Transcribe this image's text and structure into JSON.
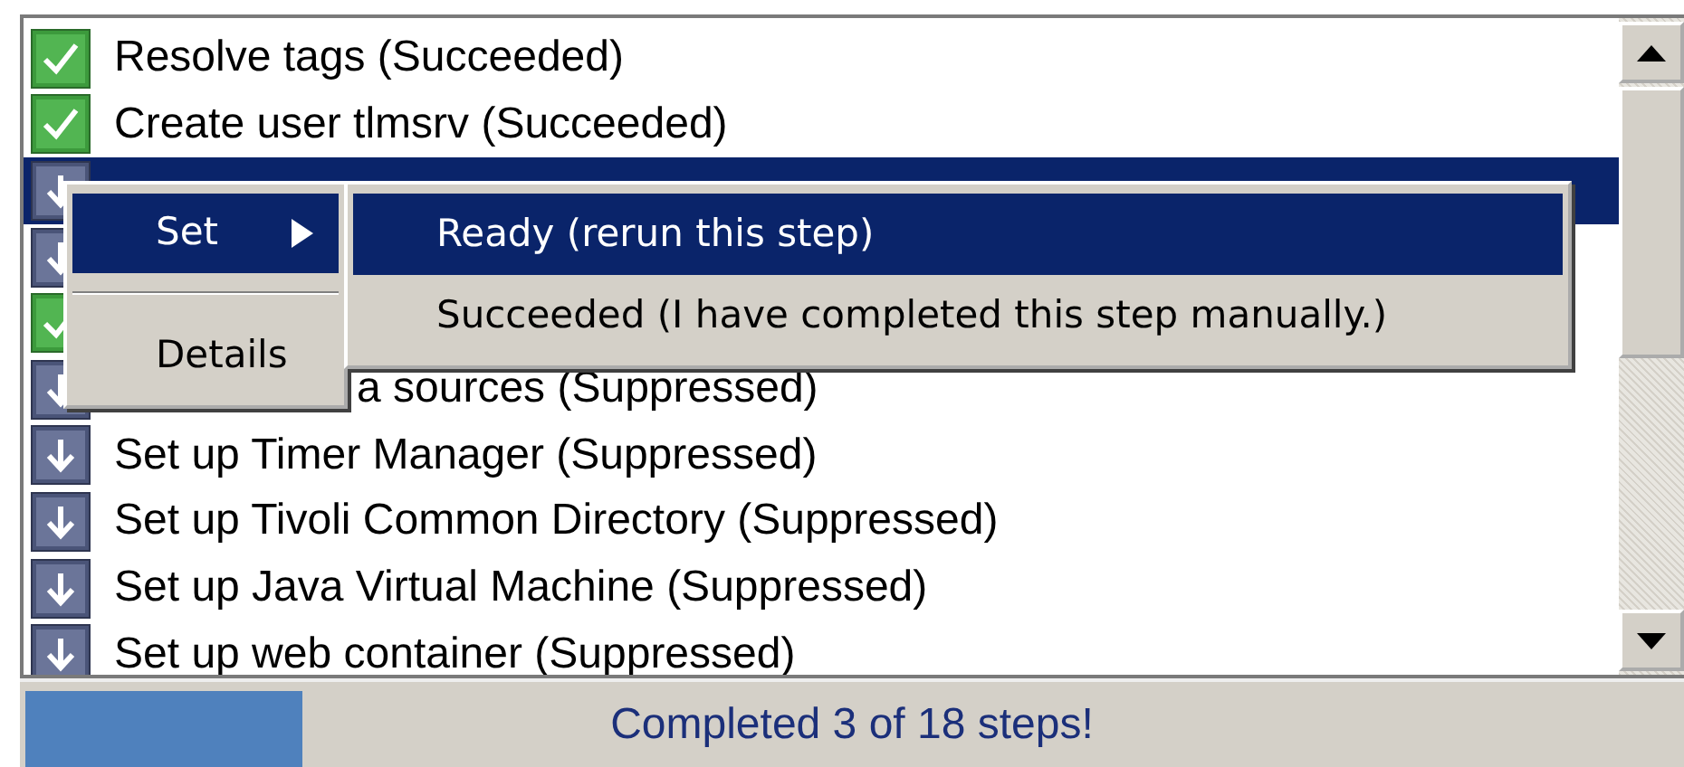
{
  "steps": [
    {
      "kind": "succeeded",
      "label": "Resolve tags  (Succeeded)",
      "selected": false
    },
    {
      "kind": "succeeded",
      "label": "Create user tlmsrv  (Succeeded)",
      "selected": false
    },
    {
      "kind": "suppressed",
      "selected": true
    },
    {
      "kind": "suppressed",
      "selected": false,
      "partly_hidden": true
    },
    {
      "kind": "succeeded",
      "selected": false,
      "partly_hidden": true
    },
    {
      "kind": "suppressed",
      "label": "a sources  (Suppressed)",
      "selected": false,
      "partly_hidden": true
    },
    {
      "kind": "suppressed",
      "label": "Set up Timer Manager  (Suppressed)",
      "selected": false
    },
    {
      "kind": "suppressed",
      "label": "Set up Tivoli Common Directory  (Suppressed)",
      "selected": false
    },
    {
      "kind": "suppressed",
      "label": "Set up Java Virtual Machine  (Suppressed)",
      "selected": false
    },
    {
      "kind": "suppressed",
      "label": "Set up web container  (Suppressed)",
      "selected": false
    }
  ],
  "context_menu": {
    "items": [
      {
        "kind": "item",
        "label": "Set",
        "selected": true,
        "has_submenu": true
      },
      {
        "kind": "separator"
      },
      {
        "kind": "item",
        "label": "Details",
        "selected": false,
        "has_submenu": false
      }
    ],
    "submenu": [
      {
        "label": "Ready (rerun this step)",
        "selected": true
      },
      {
        "label": "Succeeded (I have completed this step manually.)",
        "selected": false
      }
    ]
  },
  "status_bar": {
    "progress": {
      "level": 0.167
    },
    "message": "Completed 3 of 18 steps!"
  }
}
